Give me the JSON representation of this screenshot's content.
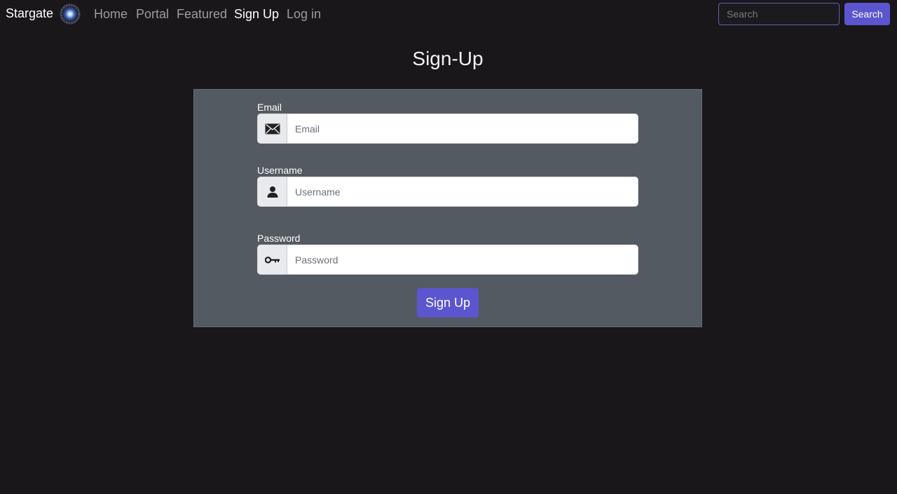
{
  "brand": {
    "name": "Stargate",
    "logo_icon": "stargate-logo-icon"
  },
  "nav": {
    "items": [
      {
        "label": "Home",
        "active": false
      },
      {
        "label": "Portal",
        "active": false
      },
      {
        "label": "Featured",
        "active": false
      },
      {
        "label": "Sign Up",
        "active": true
      },
      {
        "label": "Log in",
        "active": false
      }
    ]
  },
  "search": {
    "placeholder": "Search",
    "value": "",
    "button_label": "Search"
  },
  "page": {
    "title": "Sign-Up"
  },
  "form": {
    "email": {
      "label": "Email",
      "placeholder": "Email",
      "value": "",
      "icon": "envelope-icon"
    },
    "username": {
      "label": "Username",
      "placeholder": "Username",
      "value": "",
      "icon": "person-icon"
    },
    "password": {
      "label": "Password",
      "placeholder": "Password",
      "value": "",
      "icon": "key-icon"
    },
    "submit_label": "Sign Up"
  },
  "colors": {
    "background": "#19171a",
    "card": "#545a61",
    "accent": "#5b55d0",
    "nav_inactive": "#9d9b9f",
    "nav_active": "#ffffff"
  }
}
